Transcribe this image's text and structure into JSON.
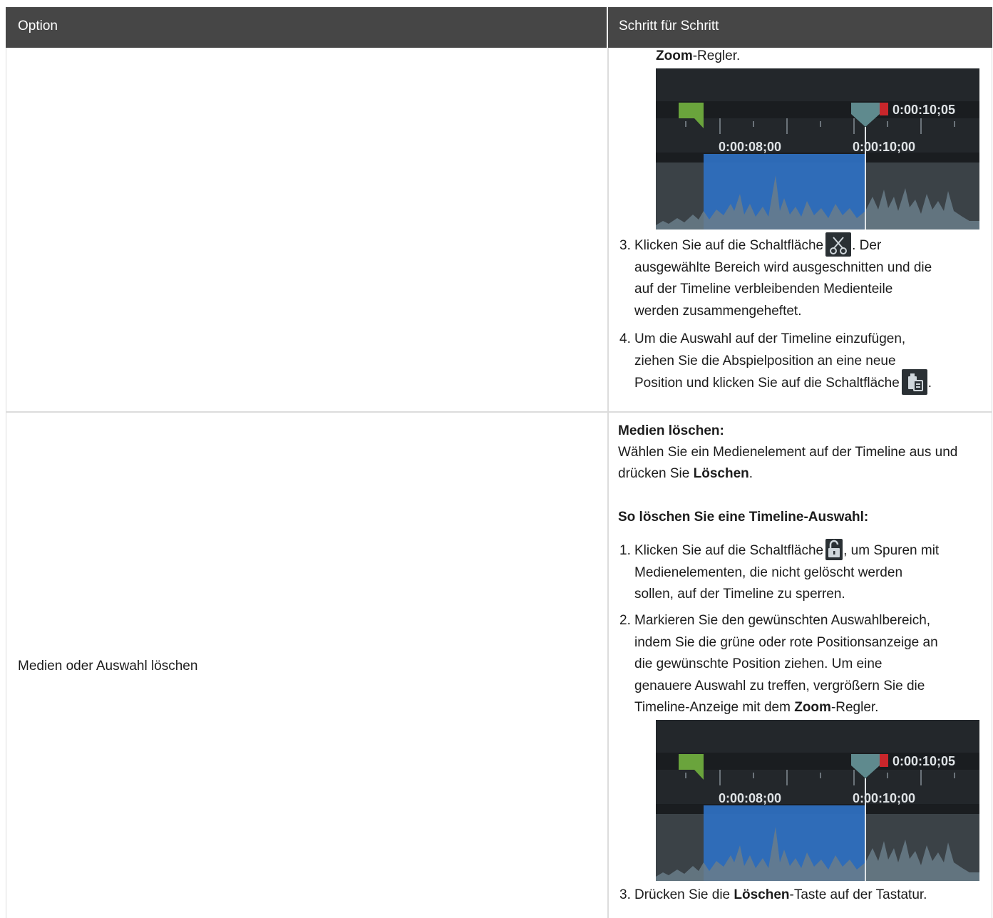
{
  "table": {
    "headers": [
      "Option",
      "Schritt für Schritt"
    ]
  },
  "row1": {
    "option": "",
    "zoom_tail": {
      "bold": "Zoom",
      "rest": "-Regler."
    },
    "step3": {
      "num": "3.",
      "before": "Klicken Sie auf die Schaltfläche",
      "after": ". Der",
      "line2": "ausgewählte Bereich wird ausgeschnitten und die",
      "line3": "auf der Timeline verbleibenden Medienteile",
      "line4": "werden zusammengeheftet."
    },
    "step4": {
      "num": "4.",
      "line1": "Um die Auswahl auf der Timeline einzufügen,",
      "line2": "ziehen Sie die Abspielposition an eine neue",
      "line3_before": "Position und klicken Sie auf die Schaltfläche",
      "line3_after": "."
    }
  },
  "row2": {
    "option": "Medien oder Auswahl löschen",
    "delete_media_heading": "Medien löschen:",
    "delete_media_line1": "Wählen Sie ein Medienelement auf der Timeline aus und",
    "delete_media_line2_before": "drücken Sie",
    "delete_media_line2_bold": "Löschen",
    "delete_media_line2_after": ".",
    "selection_heading": "So löschen Sie eine Timeline-Auswahl:",
    "step1": {
      "num": "1.",
      "before": "Klicken Sie auf die Schaltfläche",
      "after": ", um Spuren mit",
      "line2": "Medienelementen, die nicht gelöscht werden",
      "line3": "sollen, auf der Timeline zu sperren."
    },
    "step2": {
      "num": "2.",
      "line1": "Markieren Sie den gewünschten Auswahlbereich,",
      "line2": "indem Sie die grüne oder rote Positionsanzeige an",
      "line3": "die gewünschte Position ziehen. Um eine",
      "line4": "genauere Auswahl zu treffen, vergrößern Sie die",
      "line5_before": "Timeline-Anzeige mit dem",
      "line5_bold": "Zoom",
      "line5_after": "-Regler."
    },
    "step3": {
      "num": "3.",
      "before": "Drücken Sie die",
      "bold": "Löschen",
      "after": "-Taste auf der Tastatur."
    }
  },
  "timeline": {
    "end_time": "0:00:10;05",
    "tick_label_1": "0:00:08;00",
    "tick_label_2": "0:00:10;00"
  },
  "icons": {
    "cut": "scissors-icon",
    "paste": "paste-icon",
    "lock": "unlock-icon"
  },
  "colors": {
    "header_bg": "#464646",
    "selection_blue": "#2e6fbf",
    "green_marker": "#6aa43c",
    "red_marker": "#c8262b",
    "playhead": "#5f8a8e"
  }
}
